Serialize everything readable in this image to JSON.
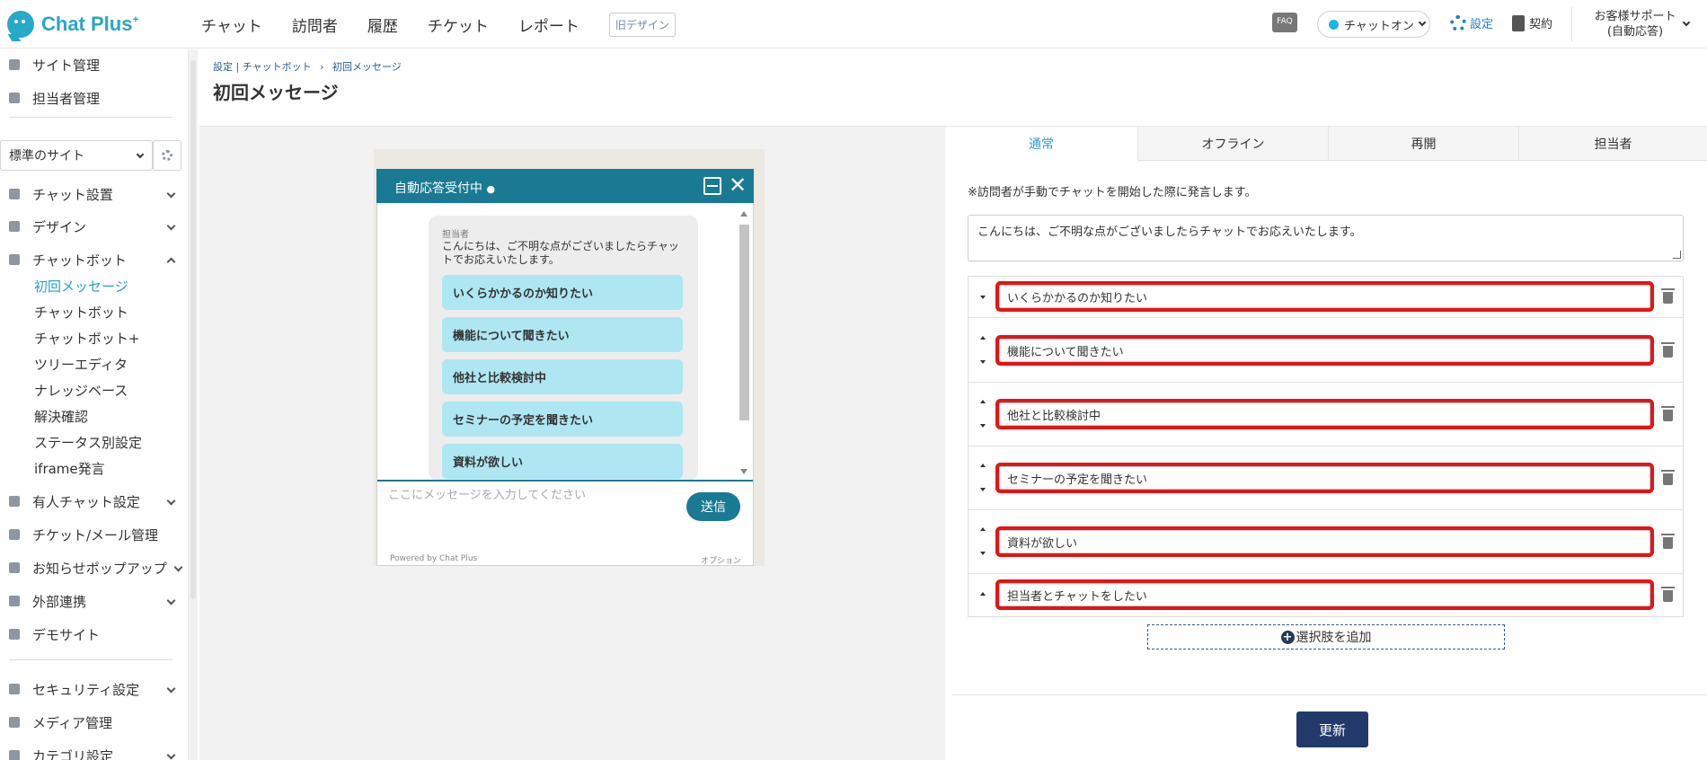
{
  "app": {
    "logo_text": "Chat Plus",
    "logo_sup": "+"
  },
  "topnav": {
    "items": [
      "チャット",
      "訪問者",
      "履歴",
      "チケット",
      "レポート"
    ],
    "old_design": "旧デザイン"
  },
  "header_right": {
    "faq": "FAQ",
    "chat_status": "チャットオン",
    "settings": "設定",
    "contract": "契約",
    "support_line1": "お客様サポート",
    "support_line2": "(自動応答)"
  },
  "sidebar": {
    "top_items": [
      "サイト管理",
      "担当者管理"
    ],
    "site_select": "標準のサイト",
    "items": [
      "チャット設置",
      "デザイン",
      "チャットボット"
    ],
    "chatbot_subs": [
      "初回メッセージ",
      "チャットボット",
      "チャットボット+",
      "ツリーエディタ",
      "ナレッジベース",
      "解決確認",
      "ステータス別設定",
      "iframe発言"
    ],
    "more_items": [
      "有人チャット設定",
      "チケット/メール管理",
      "お知らせポップアップ",
      "外部連携",
      "デモサイト"
    ],
    "bottom_items": [
      "セキュリティ設定",
      "メディア管理",
      "カテゴリ設定"
    ]
  },
  "breadcrumb": {
    "part1": "設定 | チャットボット",
    "sep": "›",
    "part2": "初回メッセージ"
  },
  "page_title": "初回メッセージ",
  "widget": {
    "header": "自動応答受付中",
    "sender": "担当者",
    "message": "こんにちは、ご不明な点がございましたらチャットでお応えいたします。",
    "options": [
      "いくらかかるのか知りたい",
      "機能について聞きたい",
      "他社と比較検討中",
      "セミナーの予定を聞きたい",
      "資料が欲しい"
    ],
    "input_placeholder": "ここにメッセージを入力してください",
    "send": "送信",
    "powered": "Powered by Chat Plus",
    "option_link": "オプション"
  },
  "tabs": [
    "通常",
    "オフライン",
    "再開",
    "担当者"
  ],
  "editor": {
    "note": "※訪問者が手動でチャットを開始した際に発言します。",
    "initial_message": "こんにちは、ご不明な点がございましたらチャットでお応えいたします。",
    "choices": [
      "いくらかかるのか知りたい",
      "機能について聞きたい",
      "他社と比較検討中",
      "セミナーの予定を聞きたい",
      "資料が欲しい",
      "担当者とチャットをしたい"
    ],
    "add_choice": "選択肢を追加",
    "update": "更新"
  },
  "colors": {
    "accent": "#2a9ed0",
    "widget_header": "#1a7a93",
    "option_bg": "#aee6f2",
    "highlight": "#e41515",
    "update_button": "#223a6a"
  }
}
